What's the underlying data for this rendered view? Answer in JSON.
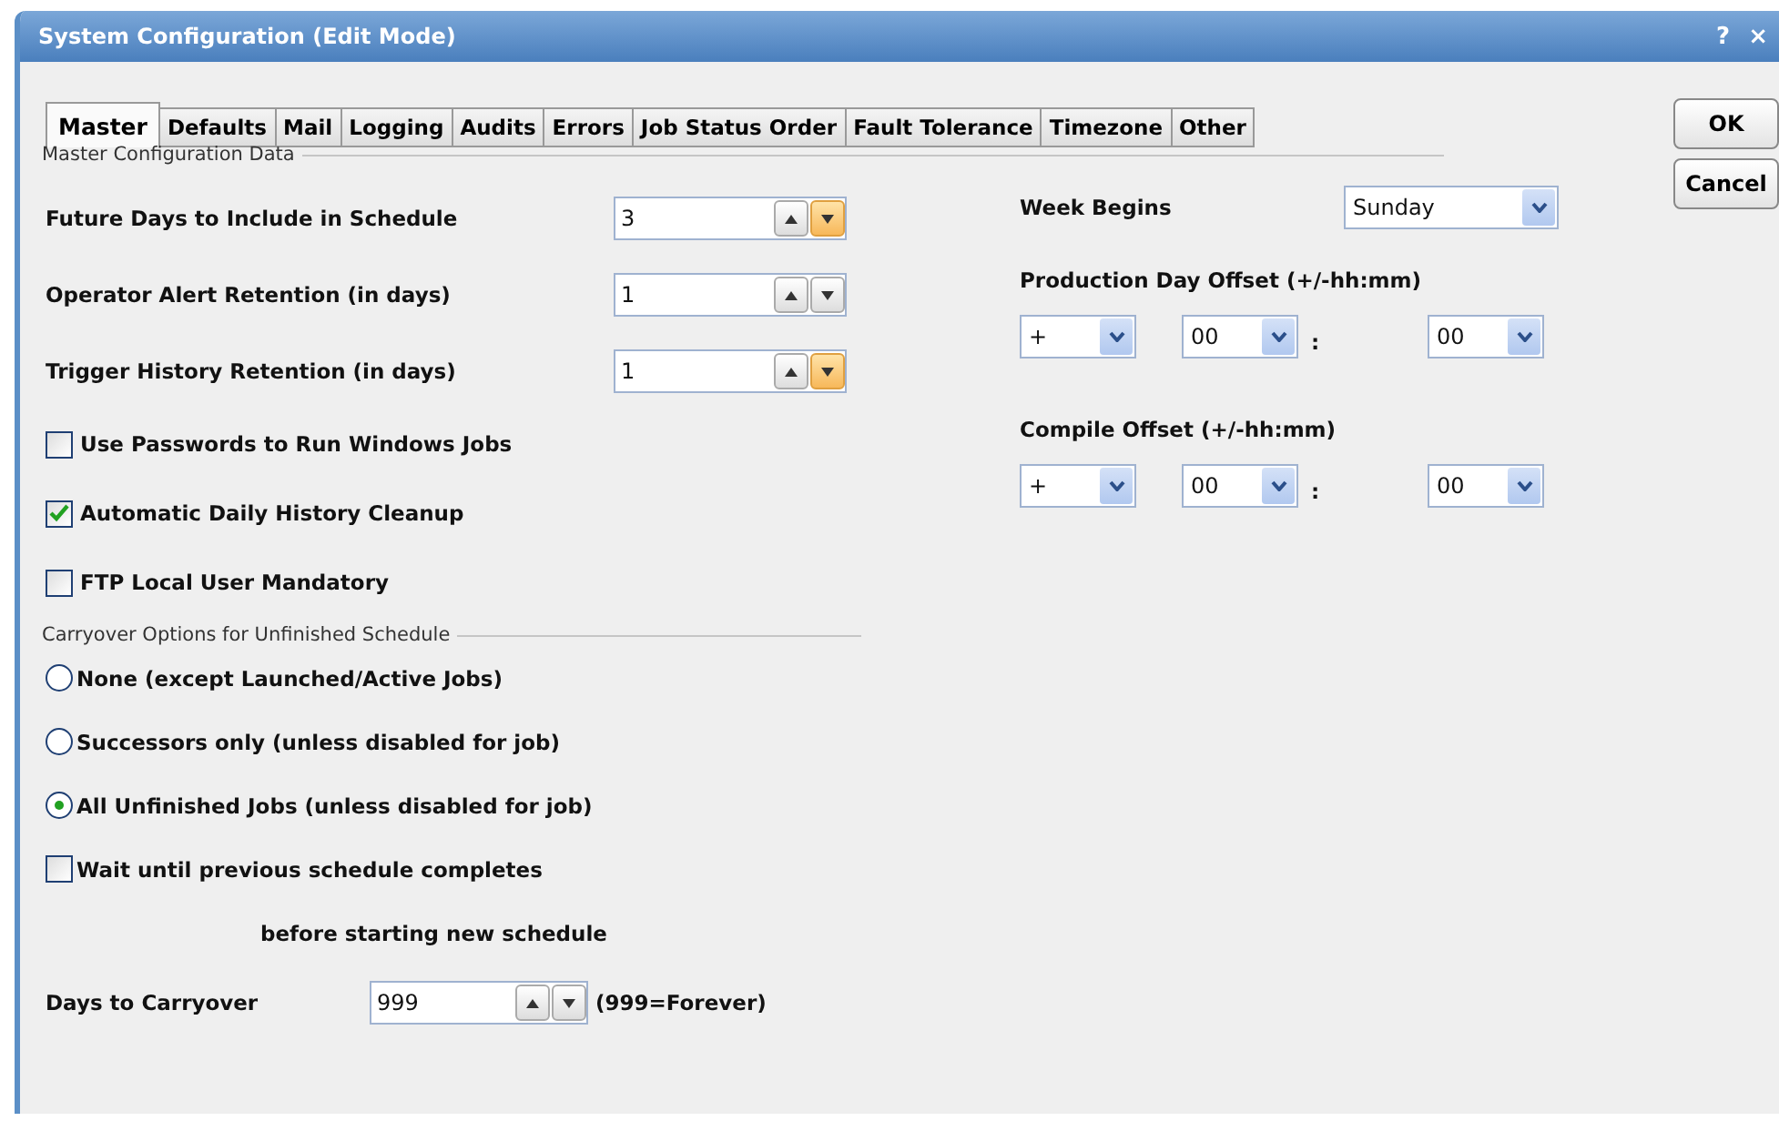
{
  "window": {
    "title": "System Configuration (Edit Mode)",
    "help": "?",
    "close": "×"
  },
  "tabs": [
    {
      "label": "Master",
      "selected": true
    },
    {
      "label": "Defaults",
      "selected": false
    },
    {
      "label": "Mail",
      "selected": false
    },
    {
      "label": "Logging",
      "selected": false
    },
    {
      "label": "Audits",
      "selected": false
    },
    {
      "label": "Errors",
      "selected": false
    },
    {
      "label": "Job Status Order",
      "selected": false
    },
    {
      "label": "Fault Tolerance",
      "selected": false
    },
    {
      "label": "Timezone",
      "selected": false
    },
    {
      "label": "Other",
      "selected": false
    }
  ],
  "buttons": [
    "OK",
    "Cancel"
  ],
  "section_title": "Master Configuration Data",
  "spinners": [
    {
      "label": "Future Days to Include in Schedule",
      "value": "3",
      "down_highlighted": true
    },
    {
      "label": "Operator Alert Retention (in days)",
      "value": "1",
      "down_highlighted": false
    },
    {
      "label": "Trigger History Retention (in days)",
      "value": "1",
      "down_highlighted": true
    }
  ],
  "checkboxes": [
    {
      "label": "Use Passwords to Run Windows Jobs",
      "checked": false
    },
    {
      "label": "Automatic Daily History Cleanup",
      "checked": true
    },
    {
      "label": "FTP Local User Mandatory",
      "checked": false
    }
  ],
  "carryover": {
    "title": "Carryover Options for Unfinished Schedule",
    "options": [
      {
        "label": "None (except Launched/Active Jobs)",
        "selected": false
      },
      {
        "label": "Successors only (unless disabled for job)",
        "selected": false
      },
      {
        "label": "All Unfinished Jobs (unless disabled for job)",
        "selected": true
      }
    ],
    "wait": {
      "label": "Wait until previous schedule completes",
      "label_2": "before starting new schedule",
      "checked": false
    },
    "days": {
      "label": "Days to Carryover",
      "value": "999",
      "note": "(999=Forever)",
      "down_highlighted": false
    }
  },
  "week_begins": {
    "label": "Week Begins",
    "value": "Sunday"
  },
  "offsets": [
    {
      "label": "Production Day Offset (+/-hh:mm)",
      "sign": "+",
      "hours": "00",
      "separator": ":",
      "minutes": "00"
    },
    {
      "label": "Compile Offset (+/-hh:mm)",
      "sign": "+",
      "hours": "00",
      "separator": ":",
      "minutes": "00"
    }
  ]
}
